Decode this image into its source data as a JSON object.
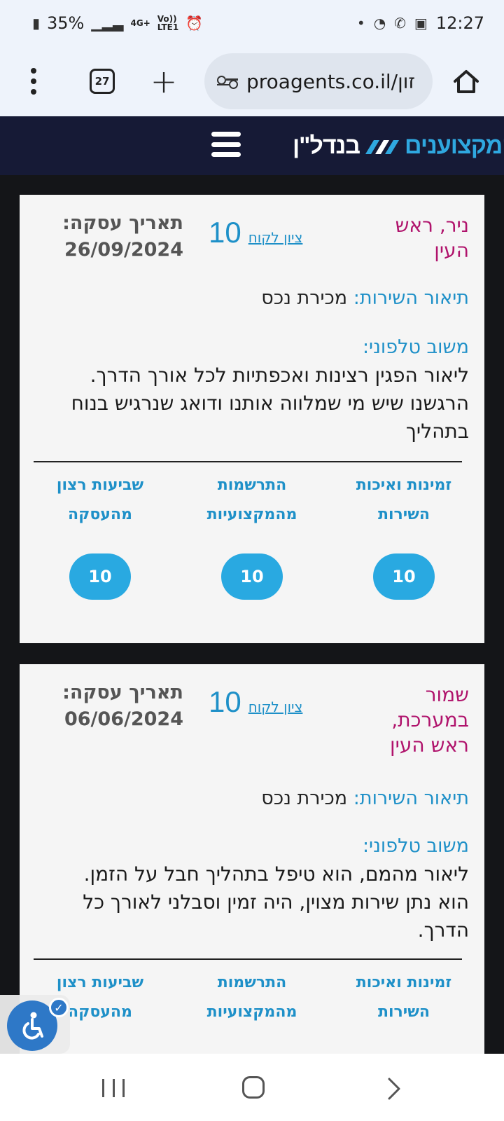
{
  "status_bar": {
    "battery": "35%",
    "network_top": "4G+",
    "network_volte": "Vo))",
    "network_lte": "LTE1",
    "time": "12:27"
  },
  "browser": {
    "tab_count": "27",
    "url": "proagents.co.il/זון"
  },
  "site": {
    "logo_part1": "המקצוענים",
    "logo_part2": "בנדל\"ן"
  },
  "reviews": [
    {
      "customer": "ניר, ראש העין",
      "score_label": "ציון לקוח",
      "score": "10",
      "date_label": "תאריך עסקה:",
      "date": "26/09/2024",
      "service_label": "תיאור השירות:",
      "service_value": "מכירת נכס",
      "feedback_label": "משוב טלפוני:",
      "feedback": "ליאור הפגין רצינות ואכפתיות לכל אורך הדרך. הרגשנו שיש מי שמלווה אותנו ודואג שנרגיש בנוח בתהליך",
      "ratings": [
        {
          "label": "זמינות ואיכות השירות",
          "value": "10"
        },
        {
          "label": "התרשמות מהמקצועיות",
          "value": "10"
        },
        {
          "label": "שביעות רצון מהעסקה",
          "value": "10"
        }
      ]
    },
    {
      "customer": "שמור במערכת, ראש העין",
      "score_label": "ציון לקוח",
      "score": "10",
      "date_label": "תאריך עסקה:",
      "date": "06/06/2024",
      "service_label": "תיאור השירות:",
      "service_value": "מכירת נכס",
      "feedback_label": "משוב טלפוני:",
      "feedback": "ליאור מהמם, הוא טיפל בתהליך חבל על הזמן. הוא נתן שירות מצוין, היה זמין וסבלני לאורך כל הדרך.",
      "ratings": [
        {
          "label": "זמינות ואיכות השירות"
        },
        {
          "label": "התרשמות מהמקצועיות"
        },
        {
          "label": "שביעות רצון מהעסקה"
        }
      ]
    }
  ],
  "colors": {
    "header_bg": "#161a36",
    "accent": "#29a9e1",
    "customer_name": "#b0136c"
  }
}
